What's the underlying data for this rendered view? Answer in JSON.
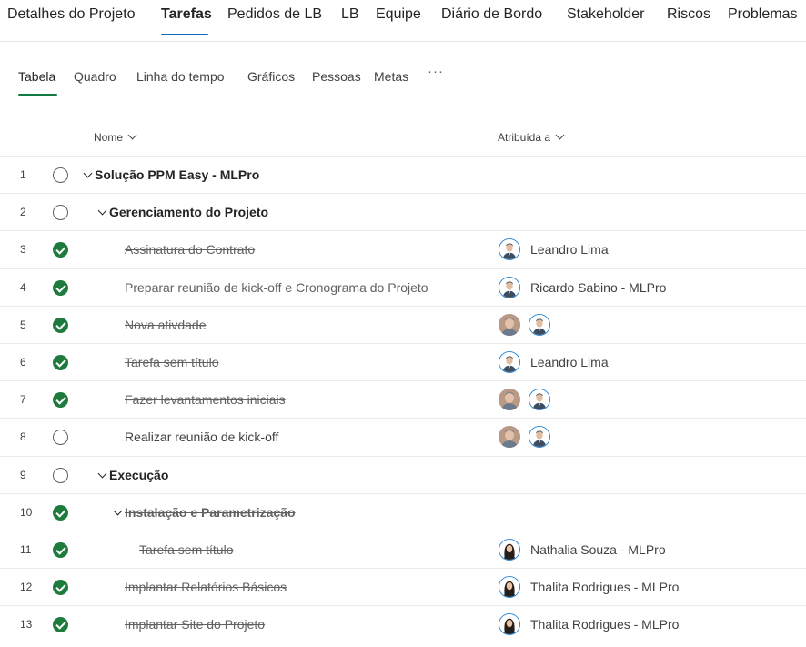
{
  "top_tabs": [
    {
      "label": "Detalhes do Projeto",
      "active": false
    },
    {
      "label": "Tarefas",
      "active": true
    },
    {
      "label": "Pedidos de LB",
      "active": false
    },
    {
      "label": "LB",
      "active": false
    },
    {
      "label": "Equipe",
      "active": false
    },
    {
      "label": "Diário de Bordo",
      "active": false
    },
    {
      "label": "Stakeholder",
      "active": false
    },
    {
      "label": "Riscos",
      "active": false
    },
    {
      "label": "Problemas",
      "active": false
    }
  ],
  "view_tabs": [
    {
      "label": "Tabela",
      "active": true
    },
    {
      "label": "Quadro",
      "active": false
    },
    {
      "label": "Linha do tempo",
      "active": false
    },
    {
      "label": "Gráficos",
      "active": false
    },
    {
      "label": "Pessoas",
      "active": false
    },
    {
      "label": "Metas",
      "active": false
    }
  ],
  "more_label": "···",
  "columns": {
    "name": "Nome",
    "assigned": "Atribuída a"
  },
  "colors": {
    "accent_blue": "#0f6cbd",
    "complete_green": "#1e7b3d"
  },
  "rows": [
    {
      "num": "1",
      "title": "Solução PPM Easy - MLPro",
      "done": false,
      "summary": true,
      "level": 0,
      "avatars": [],
      "assignee": ""
    },
    {
      "num": "2",
      "title": "Gerenciamento do Projeto",
      "done": false,
      "summary": true,
      "level": 1,
      "avatars": [],
      "assignee": ""
    },
    {
      "num": "3",
      "title": "Assinatura do Contrato",
      "done": true,
      "summary": false,
      "level": 2,
      "avatars": [
        "man-ring"
      ],
      "assignee": "Leandro Lima"
    },
    {
      "num": "4",
      "title": "Preparar reunião de kick-off e Cronograma do Projeto",
      "done": true,
      "summary": false,
      "level": 2,
      "avatars": [
        "man-ring"
      ],
      "assignee": "Ricardo Sabino - MLPro"
    },
    {
      "num": "5",
      "title": "Nova ativdade",
      "done": true,
      "summary": false,
      "level": 2,
      "avatars": [
        "man-photo",
        "man-ring"
      ],
      "assignee": ""
    },
    {
      "num": "6",
      "title": "Tarefa sem título",
      "done": true,
      "summary": false,
      "level": 2,
      "avatars": [
        "man-ring"
      ],
      "assignee": "Leandro Lima"
    },
    {
      "num": "7",
      "title": "Fazer levantamentos iniciais",
      "done": true,
      "summary": false,
      "level": 2,
      "avatars": [
        "man-photo",
        "man-ring"
      ],
      "assignee": ""
    },
    {
      "num": "8",
      "title": "Realizar reunião de kick-off",
      "done": false,
      "summary": false,
      "level": 2,
      "avatars": [
        "man-photo",
        "man-ring"
      ],
      "assignee": ""
    },
    {
      "num": "9",
      "title": "Execução",
      "done": false,
      "summary": true,
      "level": 1,
      "avatars": [],
      "assignee": ""
    },
    {
      "num": "10",
      "title": "Instalação e Parametrização",
      "done": true,
      "summary": true,
      "level": 2,
      "avatars": [],
      "assignee": ""
    },
    {
      "num": "11",
      "title": "Tarefa sem título",
      "done": true,
      "summary": false,
      "level": 3,
      "avatars": [
        "woman-ring"
      ],
      "assignee": "Nathalia Souza - MLPro"
    },
    {
      "num": "12",
      "title": "Implantar Relatórios Básicos",
      "done": true,
      "summary": false,
      "level": 2,
      "avatars": [
        "woman-ring"
      ],
      "assignee": "Thalita Rodrigues - MLPro"
    },
    {
      "num": "13",
      "title": "Implantar Site do Projeto",
      "done": true,
      "summary": false,
      "level": 2,
      "avatars": [
        "woman-ring"
      ],
      "assignee": "Thalita Rodrigues - MLPro"
    }
  ]
}
